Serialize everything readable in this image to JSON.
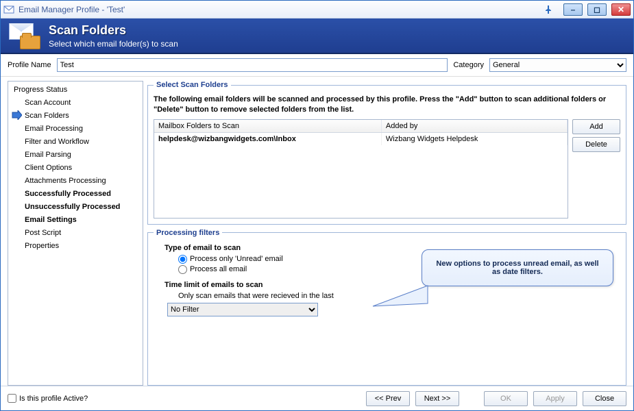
{
  "window": {
    "title": "Email Manager Profile - 'Test'"
  },
  "banner": {
    "title": "Scan Folders",
    "subtitle": "Select which email folder(s) to scan"
  },
  "profile": {
    "name_label": "Profile Name",
    "name_value": "Test",
    "category_label": "Category",
    "category_value": "General"
  },
  "sidebar": {
    "header": "Progress Status",
    "items": [
      {
        "label": "Scan Account",
        "active": false,
        "bold": false
      },
      {
        "label": "Scan Folders",
        "active": true,
        "bold": false
      },
      {
        "label": "Email Processing",
        "active": false,
        "bold": false
      },
      {
        "label": "Filter and Workflow",
        "active": false,
        "bold": false
      },
      {
        "label": "Email Parsing",
        "active": false,
        "bold": false
      },
      {
        "label": "Client Options",
        "active": false,
        "bold": false
      },
      {
        "label": "Attachments Processing",
        "active": false,
        "bold": false
      },
      {
        "label": "Successfully Processed",
        "active": false,
        "bold": true
      },
      {
        "label": "Unsuccessfully Processed",
        "active": false,
        "bold": true
      },
      {
        "label": "Email Settings",
        "active": false,
        "bold": true
      },
      {
        "label": "Post Script",
        "active": false,
        "bold": false
      },
      {
        "label": "Properties",
        "active": false,
        "bold": false
      }
    ]
  },
  "folders_group": {
    "legend": "Select Scan Folders",
    "instructions": "The following email folders will be scanned and processed by this profile. Press the \"Add\" button to scan additional folders or \"Delete\" button to remove selected folders from the list.",
    "col_folder": "Mailbox Folders to Scan",
    "col_addedby": "Added by",
    "rows": [
      {
        "folder": "helpdesk@wizbangwidgets.com\\Inbox",
        "addedby": "Wizbang Widgets Helpdesk"
      }
    ],
    "add_label": "Add",
    "delete_label": "Delete"
  },
  "filters_group": {
    "legend": "Processing filters",
    "type_label": "Type of email to scan",
    "radio_unread": "Process only 'Unread' email",
    "radio_all": "Process all email",
    "selected_radio": "unread",
    "time_label": "Time limit of emails to scan",
    "time_sub": "Only scan emails that were recieved in the last",
    "time_value": "No Filter"
  },
  "callout": {
    "text": "New options to process unread email, as well as date filters."
  },
  "footer": {
    "active_label": "Is this profile Active?",
    "active_checked": false,
    "prev": "<< Prev",
    "next": "Next >>",
    "ok": "OK",
    "apply": "Apply",
    "close": "Close"
  }
}
